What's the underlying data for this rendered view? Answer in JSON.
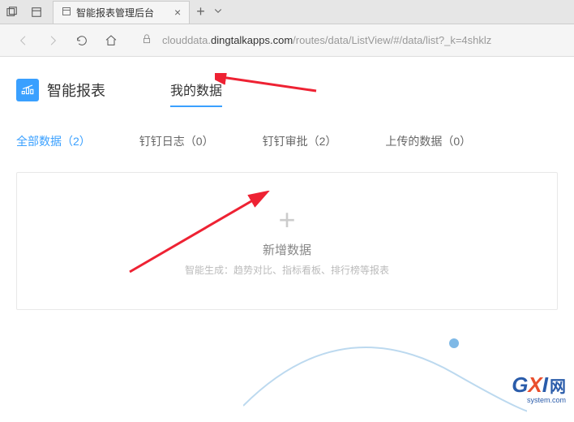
{
  "window": {
    "tab_title": "智能报表管理后台"
  },
  "url": {
    "prefix": "clouddata.",
    "domain": "dingtalkapps.com",
    "path": "/routes/data/ListView/#/data/list?_k=4shklz"
  },
  "brand": {
    "name": "智能报表"
  },
  "nav": {
    "my_data": "我的数据"
  },
  "subtabs": {
    "all": "全部数据（2）",
    "diary": "钉钉日志（0）",
    "approval": "钉钉审批（2）",
    "upload": "上传的数据（0）"
  },
  "card": {
    "title": "新增数据",
    "desc": "智能生成：趋势对比、指标看板、排行榜等报表"
  },
  "watermark": {
    "text": "网",
    "sub": "system.com"
  }
}
